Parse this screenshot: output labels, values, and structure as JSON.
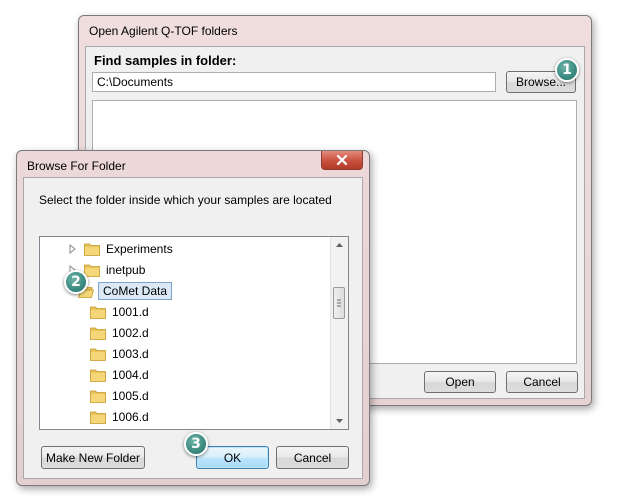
{
  "main_dialog": {
    "title": "Open Agilent Q-TOF folders",
    "find_label": "Find samples in folder:",
    "path_value": "C:\\Documents",
    "browse_button": "Browse...",
    "open_button": "Open",
    "cancel_button": "Cancel"
  },
  "browse_dialog": {
    "title": "Browse For Folder",
    "instruction": "Select the folder inside which your samples are located",
    "tree": [
      {
        "label": "Experiments",
        "expandable": true,
        "selected": false
      },
      {
        "label": "inetpub",
        "expandable": true,
        "selected": false
      },
      {
        "label": "CoMet Data",
        "expandable": false,
        "selected": true
      },
      {
        "label": "1001.d",
        "expandable": false,
        "selected": false
      },
      {
        "label": "1002.d",
        "expandable": false,
        "selected": false
      },
      {
        "label": "1003.d",
        "expandable": false,
        "selected": false
      },
      {
        "label": "1004.d",
        "expandable": false,
        "selected": false
      },
      {
        "label": "1005.d",
        "expandable": false,
        "selected": false
      },
      {
        "label": "1006.d",
        "expandable": false,
        "selected": false
      }
    ],
    "make_new_folder_button": "Make New Folder",
    "ok_button": "OK",
    "cancel_button": "Cancel"
  },
  "step_markers": [
    "1",
    "2",
    "3"
  ],
  "colors": {
    "window_frame": "#ead7d7",
    "client_bg": "#f0f0f0",
    "selection": "#dbe9f7",
    "close_button": "#c7503f",
    "marker": "#3a8a80",
    "folder": "#e8c25a"
  }
}
